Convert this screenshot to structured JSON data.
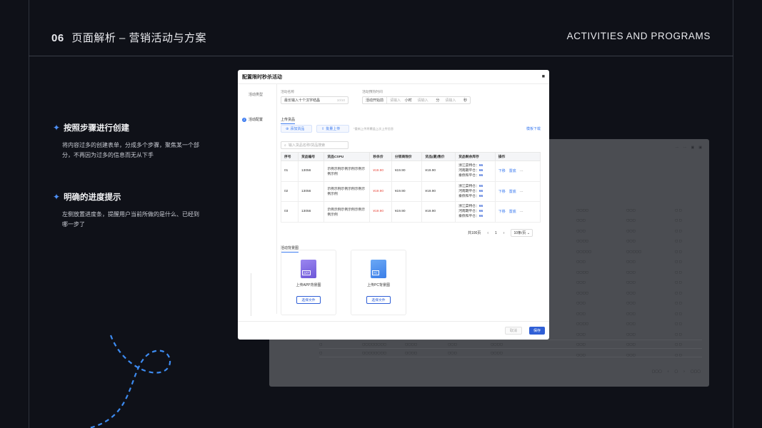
{
  "header": {
    "number": "06",
    "title": "页面解析 – 营销活动与方案",
    "title_en": "ACTIVITIES AND PROGRAMS"
  },
  "features": [
    {
      "title": "按照步骤进行创建",
      "desc": "将内容过多的创建表单，分成多个步骤，聚焦某一个部分，不再因为过多的信息而无从下手"
    },
    {
      "title": "明确的进度提示",
      "desc": "左侧放置进度条，提醒用户当前所做的是什么、已经到哪一步了"
    }
  ],
  "colors": {
    "accent": "#3d7cf0",
    "price_red": "#e84a3e",
    "primary": "#2f5fd6",
    "background": "#0f1118"
  },
  "modal": {
    "title": "配置限时秒杀活动",
    "close_icon": "close-icon",
    "steps": [
      {
        "label": "活动类型",
        "num": ""
      },
      {
        "label": "活动配置",
        "num": "2"
      }
    ],
    "name_field": {
      "label": "活动名称",
      "placeholder": "最长输入十个汉字结晶",
      "count": "10/10"
    },
    "duration_field": {
      "label": "活动预热时间",
      "start_label": "活动开始前",
      "hour_ph": "请输入",
      "hour_unit": "小时",
      "min_ph": "请输入",
      "min_unit": "分",
      "sec_ph": "请输入",
      "sec_unit": "秒"
    },
    "goods_section": {
      "tab": "上传货品",
      "add_button": "添加货品",
      "batch_button": "批量上传",
      "hint": "*重新上传将覆盖上次上传信息",
      "template_link": "模板下载",
      "search_placeholder": "输入货品名称/货品搜索"
    },
    "table": {
      "headers": [
        "序号",
        "货品编号",
        "货品CSPU",
        "秒杀价",
        "分销商限价",
        "货品(最)售价",
        "货品剩余库存",
        "操作"
      ],
      "rows": [
        {
          "no": "01",
          "code": "13056",
          "cspu": "示例示例示例示例示例示例示例",
          "price": "¥19.90",
          "limit": "¥19.90",
          "sale": "¥19.90",
          "stock": [
            [
              "浙江菜特仓：",
              "66"
            ],
            [
              "河南期平仓：",
              "66"
            ],
            [
              "秦债和平仓：",
              "66"
            ]
          ],
          "op1": "下移",
          "op2": "置底",
          "more": "···"
        },
        {
          "no": "02",
          "code": "13056",
          "cspu": "示例示例示例示例示例示例示例",
          "price": "¥19.90",
          "limit": "¥19.90",
          "sale": "¥19.90",
          "stock": [
            [
              "浙江菜特仓：",
              "66"
            ],
            [
              "河南期平仓：",
              "66"
            ],
            [
              "秦债和平仓：",
              "66"
            ]
          ],
          "op1": "下移",
          "op2": "置底",
          "more": "···"
        },
        {
          "no": "03",
          "code": "13056",
          "cspu": "示例示例示例示例示例示例示例",
          "price": "¥19.90",
          "limit": "¥19.90",
          "sale": "¥19.90",
          "stock": [
            [
              "浙江菜特仓：",
              "66"
            ],
            [
              "河南期平仓：",
              "66"
            ],
            [
              "秦债和平仓：",
              "66"
            ]
          ],
          "op1": "下移",
          "op2": "置底",
          "more": "···"
        }
      ]
    },
    "pager": {
      "total": "共100页",
      "prev": "‹",
      "page": "1",
      "next": "›",
      "size": "10条/页"
    },
    "bg_section": {
      "tab": "活动背景图",
      "app": {
        "label": "上传APP背景图",
        "button": "选择文件",
        "icon_text": "APP"
      },
      "pc": {
        "label": "上传PC背景图",
        "button": "选择文件",
        "icon_text": "PC"
      }
    },
    "footer": {
      "cancel": "取消",
      "save": "保存"
    }
  }
}
